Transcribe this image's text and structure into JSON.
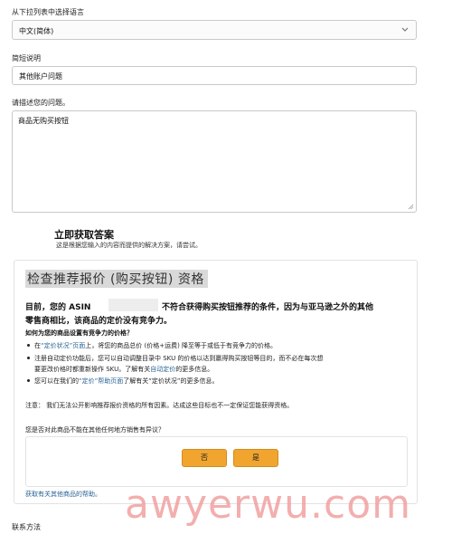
{
  "form": {
    "language_label": "从下拉列表中选择语言",
    "language_value": "中文(简体)",
    "summary_label": "简短说明",
    "summary_value": "其他账户问题",
    "describe_label": "请描述您的问题。",
    "describe_value": "商品无购买按钮"
  },
  "answer": {
    "title": "立即获取答案",
    "subtitle": "这是根据您输入的内容而提供的解决方案，请尝试。"
  },
  "card": {
    "title": "检查推荐报价 (购买按钮) 资格",
    "p1_a": "目前，您的 ASIN",
    "p1_b": "不符合获得购买按钮推荐的条件，因为与亚马逊之外的其他",
    "p1_c": "零售商相比，该商品的定价没有竞争力。",
    "q1": "如何为您的商品设置有竞争力的价格？",
    "b1_pre": "在",
    "b1_link": "“定价状况”页面",
    "b1_post": "上，将您的商品总价 (价格+运费) 降至等于或低于有竞争力的价格。",
    "b2_l1": "注册自动定价功能后，您可以自动调整目录中 SKU 的价格以达到赢得购买按钮等目的，而不必在每次想",
    "b2_l2_pre": "要更改价格时都重新操作 SKU。了解有关",
    "b2_l2_link": "自动定价",
    "b2_l2_post": "的更多信息。",
    "b3_pre": "您可以在我们的",
    "b3_link": "“定价”帮助页面",
    "b3_post": "了解有关“定价状况”的更多信息。",
    "note": "注意： 我们无法公开影响推荐报价资格的所有因素。达成这些目标也不一定保证您能获得资格。",
    "question": "您是否对此商品不能在其他任何地方销售有异议？",
    "no_label": "否",
    "yes_label": "是",
    "help_link": "获取有关其他商品的帮助。"
  },
  "contact_label": "联系方法",
  "watermark": "awyerwu.com"
}
